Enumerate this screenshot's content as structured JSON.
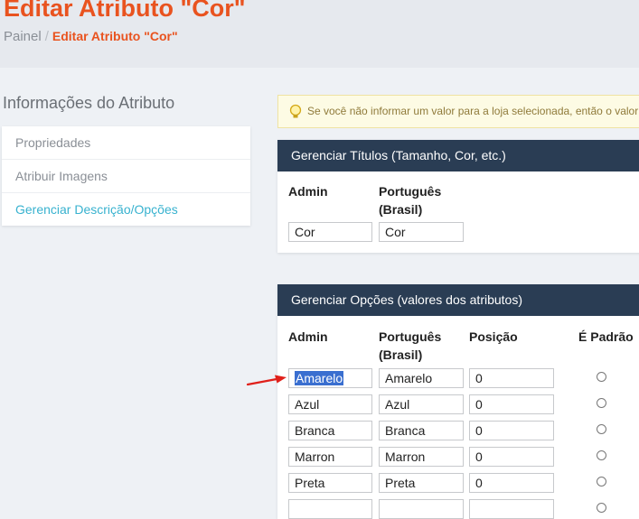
{
  "header": {
    "title": "Editar Atributo \"Cor\"",
    "breadcrumb": {
      "home": "Painel",
      "separator": "/",
      "current": "Editar Atributo \"Cor\""
    }
  },
  "sidebar": {
    "title": "Informações do Atributo",
    "items": [
      {
        "label": "Propriedades",
        "active": false
      },
      {
        "label": "Atribuir Imagens",
        "active": false
      },
      {
        "label": "Gerenciar Descrição/Opções",
        "active": true
      }
    ]
  },
  "notice": {
    "icon": "lightbulb-icon",
    "text": "Se você não informar um valor para a loja selecionada, então o valor p"
  },
  "titles_panel": {
    "heading": "Gerenciar Títulos (Tamanho, Cor, etc.)",
    "col_admin": "Admin",
    "col_pt": "Português",
    "col_pt2": "(Brasil)",
    "admin_value": "Cor",
    "pt_value": "Cor"
  },
  "options_panel": {
    "heading": "Gerenciar Opções (valores dos atributos)",
    "col_admin": "Admin",
    "col_pt": "Português",
    "col_pt2": "(Brasil)",
    "col_position": "Posição",
    "col_default": "É Padrão",
    "rows": [
      {
        "admin": "Amarelo",
        "pt": "Amarelo",
        "position": "0"
      },
      {
        "admin": "Azul",
        "pt": "Azul",
        "position": "0"
      },
      {
        "admin": "Branca",
        "pt": "Branca",
        "position": "0"
      },
      {
        "admin": "Marron",
        "pt": "Marron",
        "position": "0"
      },
      {
        "admin": "Preta",
        "pt": "Preta",
        "position": "0"
      }
    ]
  },
  "colors": {
    "accent": "#e9531f",
    "panel_header": "#2a3d54",
    "active_link": "#38b2cf",
    "selection": "#3a6fd0",
    "arrow": "#e0201a"
  }
}
